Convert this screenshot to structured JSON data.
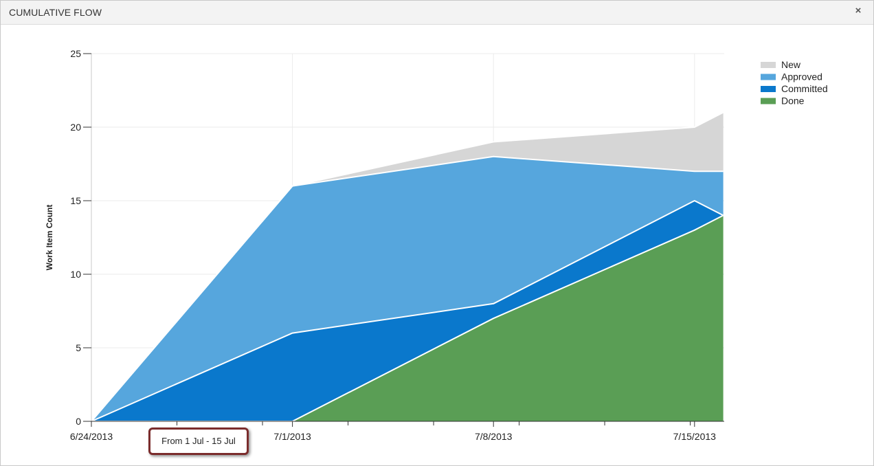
{
  "window": {
    "title": "CUMULATIVE FLOW",
    "close_icon": "close-icon",
    "close_glyph": "×"
  },
  "range_label": "From 1 Jul - 15 Jul",
  "chart_data": {
    "type": "area",
    "stacked": true,
    "title": "",
    "xlabel": "",
    "ylabel": "Work Item Count",
    "ylim": [
      0,
      25
    ],
    "yticks": [
      0,
      5,
      10,
      15,
      20,
      25
    ],
    "x": [
      "2013-06-24",
      "2013-07-01",
      "2013-07-08",
      "2013-07-15",
      "2013-07-16"
    ],
    "xtick_labels": [
      "6/24/2013",
      "7/1/2013",
      "7/8/2013",
      "7/15/2013"
    ],
    "grid": true,
    "legend_position": "top-right",
    "series": [
      {
        "name": "Done",
        "color": "#5a9e55",
        "values": [
          0,
          0,
          7,
          13,
          14
        ]
      },
      {
        "name": "Committed",
        "color": "#0a78cc",
        "values": [
          0,
          6,
          1,
          2,
          0
        ]
      },
      {
        "name": "Approved",
        "color": "#56a6dd",
        "values": [
          0,
          10,
          10,
          2,
          3
        ]
      },
      {
        "name": "New",
        "color": "#d6d6d6",
        "values": [
          0,
          0,
          1,
          3,
          4
        ]
      }
    ],
    "legend_order": [
      "New",
      "Approved",
      "Committed",
      "Done"
    ]
  }
}
